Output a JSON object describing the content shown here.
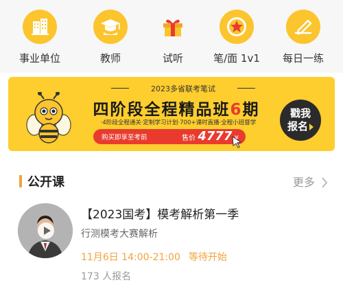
{
  "nav_icons": [
    {
      "label": "事业单位",
      "icon": "building-icon"
    },
    {
      "label": "教师",
      "icon": "graduation-cap-icon"
    },
    {
      "label": "试听",
      "icon": "gift-box-icon"
    },
    {
      "label": "笔/面 1v1",
      "icon": "star-badge-icon"
    },
    {
      "label": "每日一练",
      "icon": "pencil-note-icon"
    }
  ],
  "banner": {
    "subtitle": "2023多省联考笔试",
    "title_main": "四阶段全程精品班",
    "title_num": "6",
    "title_suffix": "期",
    "desc": "·4阶段全程通关·定制学习计划·700+课时直播·全程小班督学",
    "price_note": "购买即享至考前",
    "price_prefix": "售价",
    "price": "4777",
    "price_unit": "¥",
    "cta_line1": "戳我",
    "cta_line2": "报名"
  },
  "section": {
    "title": "公开课",
    "more_label": "更多"
  },
  "course": {
    "title": "【2023国考】模考解析第一季",
    "subtitle": "行测模考大赛解析",
    "time": "11月6日 14:00-21:00",
    "status": "等待开始",
    "count": "173 人报名"
  },
  "colors": {
    "icon_yellow": "#fcc42d",
    "accent_orange": "#f3a23a",
    "banner_yellow": "#fecd2e",
    "price_red": "#e83b2e"
  }
}
